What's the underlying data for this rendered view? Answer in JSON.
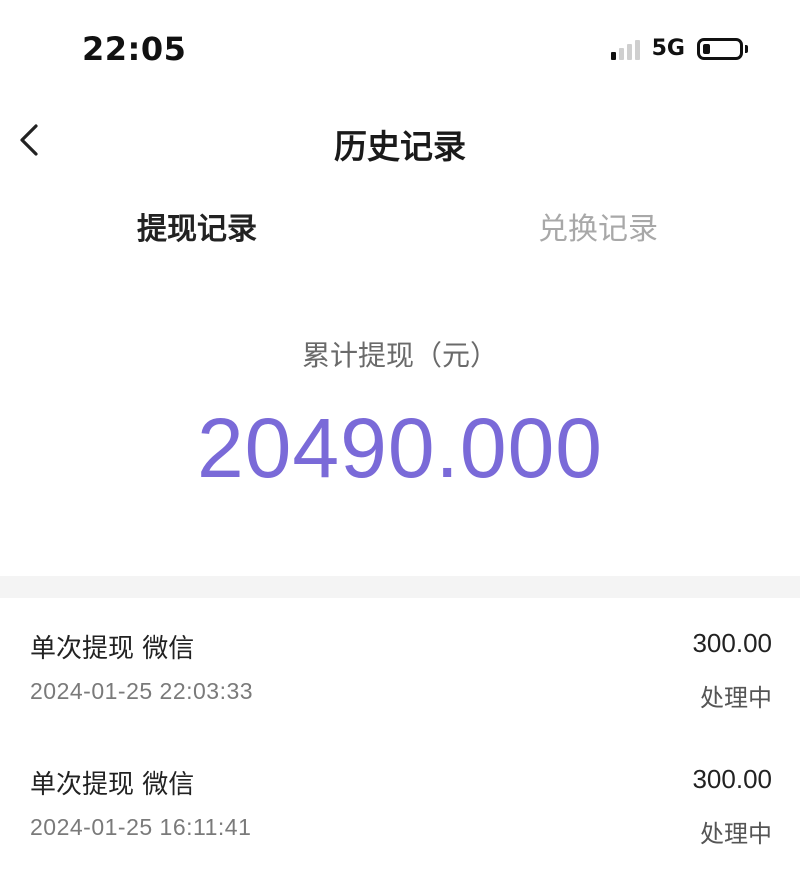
{
  "status_bar": {
    "time": "22:05",
    "network": "5G",
    "signal_bars_active": 1,
    "battery_level": 0.22
  },
  "nav": {
    "title": "历史记录",
    "back_icon": "chevron-left-icon"
  },
  "tabs": [
    {
      "label": "提现记录",
      "active": true
    },
    {
      "label": "兑换记录",
      "active": false
    }
  ],
  "summary": {
    "label": "累计提现（元）",
    "amount": "20490.000",
    "amount_color": "#7a6ad8"
  },
  "records": [
    {
      "title": "单次提现 微信",
      "time": "2024-01-25 22:03:33",
      "amount": "300.00",
      "status": "处理中"
    },
    {
      "title": "单次提现 微信",
      "time": "2024-01-25 16:11:41",
      "amount": "300.00",
      "status": "处理中"
    }
  ]
}
